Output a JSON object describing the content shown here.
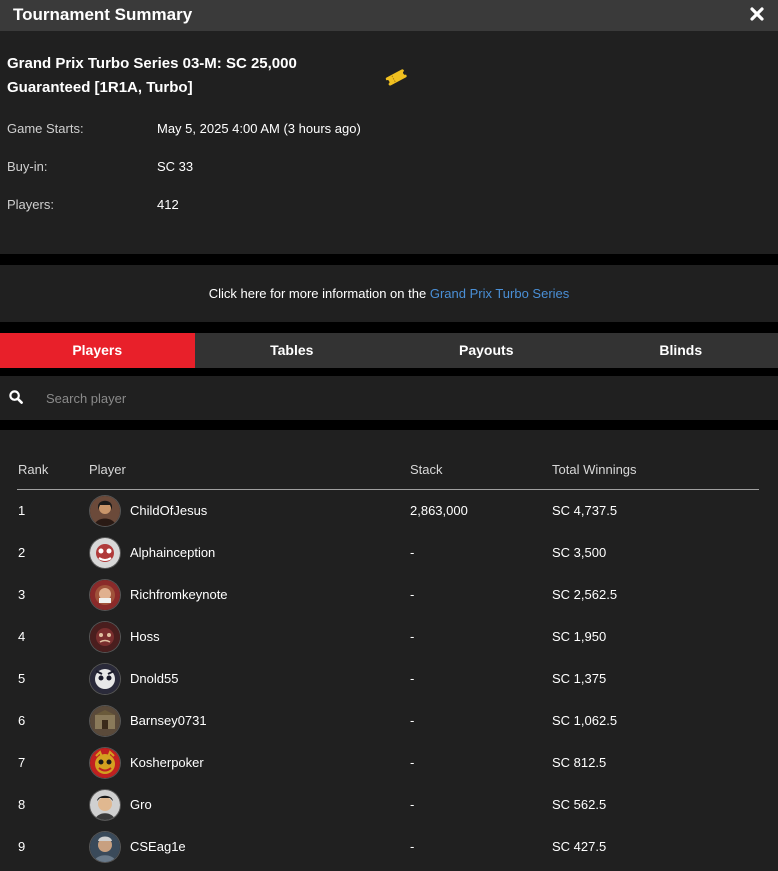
{
  "window": {
    "title": "Tournament Summary",
    "close_icon": "close-icon"
  },
  "tournament": {
    "name": "Grand Prix Turbo Series 03-M: SC 25,000 Guaranteed [1R1A, Turbo]",
    "ticket_icon": "ticket-icon",
    "game_starts_label": "Game Starts:",
    "game_starts_value": "May 5, 2025 4:00 AM (3 hours ago)",
    "buyin_label": "Buy-in:",
    "buyin_value": "SC 33",
    "players_label": "Players:",
    "players_value": "412"
  },
  "more_info": {
    "text": "Click here for more information on the ",
    "link": "Grand Prix Turbo Series"
  },
  "tabs": [
    {
      "label": "Players",
      "active": true
    },
    {
      "label": "Tables",
      "active": false
    },
    {
      "label": "Payouts",
      "active": false
    },
    {
      "label": "Blinds",
      "active": false
    }
  ],
  "search": {
    "icon": "search-icon",
    "placeholder": "Search player",
    "value": ""
  },
  "table": {
    "headers": {
      "rank": "Rank",
      "player": "Player",
      "stack": "Stack",
      "winnings": "Total Winnings"
    },
    "rows": [
      {
        "rank": "1",
        "player": "ChildOfJesus",
        "stack": "2,863,000",
        "winnings": "SC 4,737.5",
        "avatar_color": "#6b4a3a"
      },
      {
        "rank": "2",
        "player": "Alphainception",
        "stack": "-",
        "winnings": "SC 3,500",
        "avatar_color": "#b03a3a"
      },
      {
        "rank": "3",
        "player": "Richfromkeynote",
        "stack": "-",
        "winnings": "SC 2,562.5",
        "avatar_color": "#a0523a"
      },
      {
        "rank": "4",
        "player": "Hoss",
        "stack": "-",
        "winnings": "SC 1,950",
        "avatar_color": "#7a2e2e"
      },
      {
        "rank": "5",
        "player": "Dnold55",
        "stack": "-",
        "winnings": "SC 1,375",
        "avatar_color": "#5a5a6a"
      },
      {
        "rank": "6",
        "player": "Barnsey0731",
        "stack": "-",
        "winnings": "SC 1,062.5",
        "avatar_color": "#8a7a5a"
      },
      {
        "rank": "7",
        "player": "Kosherpoker",
        "stack": "-",
        "winnings": "SC 812.5",
        "avatar_color": "#d4a020"
      },
      {
        "rank": "8",
        "player": "Gro",
        "stack": "-",
        "winnings": "SC 562.5",
        "avatar_color": "#3a3a3a"
      },
      {
        "rank": "9",
        "player": "CSEag1e",
        "stack": "-",
        "winnings": "SC 427.5",
        "avatar_color": "#6a7a8a"
      }
    ]
  },
  "colors": {
    "accent_tab": "#e8202a",
    "link": "#4a8fd6",
    "panel_bg": "#202020",
    "titlebar_bg": "#3a3a3a"
  }
}
